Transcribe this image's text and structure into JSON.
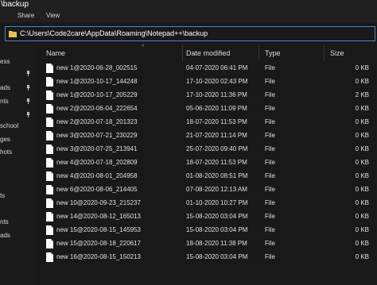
{
  "window": {
    "title": "\\backup"
  },
  "ribbon": {
    "tabs": [
      "Share",
      "View"
    ]
  },
  "address": {
    "path": "C:\\Users\\Code2care\\AppData\\Roaming\\Notepad++\\backup"
  },
  "sidebar": {
    "items": [
      "ess",
      "ads",
      "nts",
      "school",
      "ges",
      "hots",
      "ts",
      "nts",
      "ads"
    ]
  },
  "columns": {
    "name": "Name",
    "date": "Date modified",
    "type": "Type",
    "size": "Size"
  },
  "files": [
    {
      "name": "new 1@2020-06-28_002515",
      "date": "04-07-2020 06:41 PM",
      "type": "File",
      "size": "0 KB"
    },
    {
      "name": "new 1@2020-10-17_144248",
      "date": "17-10-2020 02:43 PM",
      "type": "File",
      "size": "0 KB"
    },
    {
      "name": "new 1@2020-10-17_205229",
      "date": "17-10-2020 11:36 PM",
      "type": "File",
      "size": "2 KB"
    },
    {
      "name": "new 2@2020-06-04_222654",
      "date": "05-06-2020 11:09 PM",
      "type": "File",
      "size": "0 KB"
    },
    {
      "name": "new 2@2020-07-18_201323",
      "date": "18-07-2020 11:53 PM",
      "type": "File",
      "size": "0 KB"
    },
    {
      "name": "new 3@2020-07-21_230229",
      "date": "21-07-2020 11:14 PM",
      "type": "File",
      "size": "0 KB"
    },
    {
      "name": "new 3@2020-07-25_213941",
      "date": "25-07-2020 09:40 PM",
      "type": "File",
      "size": "0 KB"
    },
    {
      "name": "new 4@2020-07-18_202809",
      "date": "18-07-2020 11:53 PM",
      "type": "File",
      "size": "0 KB"
    },
    {
      "name": "new 4@2020-08-01_204958",
      "date": "01-08-2020 08:51 PM",
      "type": "File",
      "size": "0 KB"
    },
    {
      "name": "new 6@2020-08-06_214405",
      "date": "07-08-2020 12:13 AM",
      "type": "File",
      "size": "0 KB"
    },
    {
      "name": "new 10@2020-09-23_215237",
      "date": "01-10-2020 10:27 PM",
      "type": "File",
      "size": "0 KB"
    },
    {
      "name": "new 14@2020-08-12_165013",
      "date": "15-08-2020 03:04 PM",
      "type": "File",
      "size": "0 KB"
    },
    {
      "name": "new 15@2020-08-15_145953",
      "date": "15-08-2020 03:04 PM",
      "type": "File",
      "size": "0 KB"
    },
    {
      "name": "new 15@2020-08-18_220617",
      "date": "18-08-2020 11:38 PM",
      "type": "File",
      "size": "0 KB"
    },
    {
      "name": "new 16@2020-08-15_150213",
      "date": "15-08-2020 03:04 PM",
      "type": "File",
      "size": "0 KB"
    }
  ],
  "colors": {
    "background": "#191919",
    "address_border": "#4a86c8",
    "folder": "#e8c14a"
  }
}
